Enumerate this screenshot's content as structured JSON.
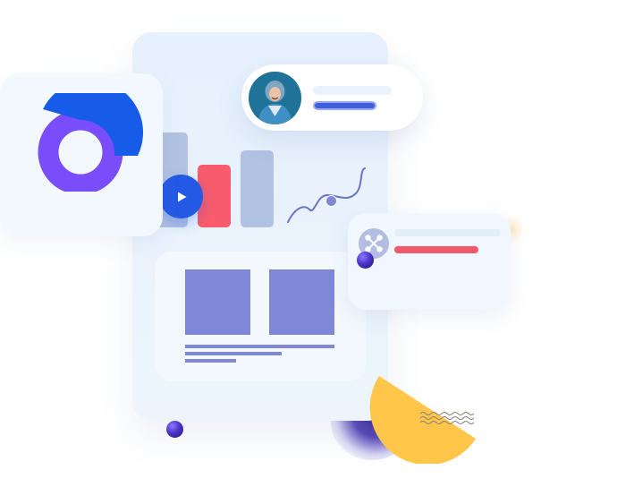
{
  "colors": {
    "primary_blue": "#2459e6",
    "accent_red": "#f85c6c",
    "accent_purple": "#7f87d8",
    "donut_purple": "#7a4dfa",
    "donut_blue": "#165ce8",
    "accent_yellow": "#ffc64a",
    "muted_bar": "#b2c2e2"
  },
  "icons": {
    "play": "play-icon",
    "node": "node-icon",
    "avatar": "avatar"
  }
}
